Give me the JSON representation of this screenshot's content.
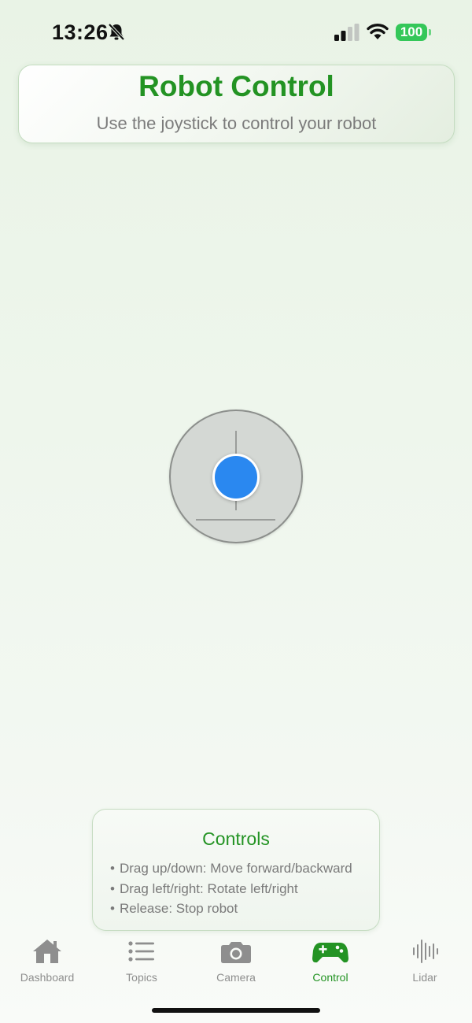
{
  "status_bar": {
    "time": "13:26",
    "battery": "100",
    "icons": [
      "bell-slash-icon",
      "signal-icon",
      "wifi-icon",
      "battery-icon"
    ]
  },
  "header": {
    "title": "Robot Control",
    "subtitle": "Use the joystick to control your robot"
  },
  "joystick": {
    "knob_x": 0,
    "knob_y": 0,
    "colors": {
      "knob": "#2a88f0",
      "base": "#d4d8d4"
    }
  },
  "controls": {
    "title": "Controls",
    "items": [
      "Drag up/down: Move forward/backward",
      "Drag left/right: Rotate left/right",
      "Release: Stop robot"
    ]
  },
  "tabs": [
    {
      "label": "Dashboard",
      "icon": "house-icon",
      "active": false
    },
    {
      "label": "Topics",
      "icon": "list-icon",
      "active": false
    },
    {
      "label": "Camera",
      "icon": "camera-icon",
      "active": false
    },
    {
      "label": "Control",
      "icon": "gamecontroller-icon",
      "active": true
    },
    {
      "label": "Lidar",
      "icon": "waveform-icon",
      "active": false
    }
  ],
  "colors": {
    "accent": "#239323",
    "inactive": "#8e8e8e"
  }
}
